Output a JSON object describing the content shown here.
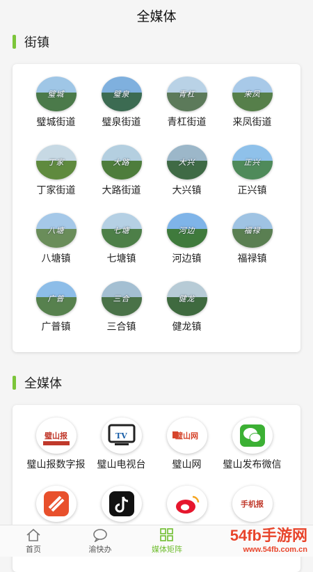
{
  "header": {
    "title": "全媒体"
  },
  "sections": [
    {
      "title": "街镇",
      "items": [
        {
          "label": "璧城街道",
          "caption": "璧城",
          "sky": "#9fc6e6",
          "land": "#4b7a4a"
        },
        {
          "label": "璧泉街道",
          "caption": "璧泉",
          "sky": "#7fb0de",
          "land": "#3c6b52"
        },
        {
          "label": "青杠街道",
          "caption": "青杠",
          "sky": "#b9d2e6",
          "land": "#5c7a5a"
        },
        {
          "label": "来凤街道",
          "caption": "来凤",
          "sky": "#a8c9e8",
          "land": "#567f4a"
        },
        {
          "label": "丁家街道",
          "caption": "丁家",
          "sky": "#c7d9e4",
          "land": "#5f8a3e"
        },
        {
          "label": "大路街道",
          "caption": "大路",
          "sky": "#b4cfe0",
          "land": "#4e7d3c"
        },
        {
          "label": "大兴镇",
          "caption": "大兴",
          "sky": "#9cb7c9",
          "land": "#3f6a45"
        },
        {
          "label": "正兴镇",
          "caption": "正兴",
          "sky": "#8fc1ea",
          "land": "#4f8a5a"
        },
        {
          "label": "八塘镇",
          "caption": "八塘",
          "sky": "#a5c8e8",
          "land": "#6a8d5a"
        },
        {
          "label": "七塘镇",
          "caption": "七塘",
          "sky": "#b5d0e4",
          "land": "#4d7f48"
        },
        {
          "label": "河边镇",
          "caption": "河边",
          "sky": "#7fb4e8",
          "land": "#3f7a3c"
        },
        {
          "label": "福禄镇",
          "caption": "福禄",
          "sky": "#9fc3e3",
          "land": "#5a7f52"
        },
        {
          "label": "广普镇",
          "caption": "广普",
          "sky": "#8dbde8",
          "land": "#57814e"
        },
        {
          "label": "三合镇",
          "caption": "三合",
          "sky": "#a4bfd2",
          "land": "#4a7248"
        },
        {
          "label": "健龙镇",
          "caption": "健龙",
          "sky": "#b7cbd6",
          "land": "#3f6a3f"
        }
      ]
    },
    {
      "title": "全媒体",
      "items": [
        {
          "label": "璧山报数字报",
          "icon": "newspaper-logo-icon",
          "logo_text": "璧山报",
          "color": "#c0392b"
        },
        {
          "label": "璧山电视台",
          "icon": "tv-icon",
          "logo_text": "TV",
          "color": "#1a5fa8"
        },
        {
          "label": "璧山网",
          "icon": "website-logo-icon",
          "logo_text": "璧山网",
          "color": "#d6452c"
        },
        {
          "label": "璧山发布微信",
          "icon": "wechat-icon",
          "logo_text": "",
          "color": "#3cb034"
        },
        {
          "label": "",
          "icon": "app-logo-icon",
          "logo_text": "",
          "color": "#e8502c"
        },
        {
          "label": "",
          "icon": "douyin-icon",
          "logo_text": "",
          "color": "#111111"
        },
        {
          "label": "",
          "icon": "weibo-icon",
          "logo_text": "",
          "color": "#e6162d"
        },
        {
          "label": "",
          "icon": "mobile-newspaper-icon",
          "logo_text": "手机报",
          "color": "#c0392b"
        }
      ]
    }
  ],
  "tabs": [
    {
      "label": "首页",
      "icon": "home-icon",
      "active": false
    },
    {
      "label": "渝快办",
      "icon": "chat-bubble-icon",
      "active": false
    },
    {
      "label": "媒体矩阵",
      "icon": "grid-icon",
      "active": true
    }
  ],
  "watermark": {
    "main": "54fb手游网",
    "sub": "www.54fb.com.cn"
  },
  "colors": {
    "accent": "#7cc53a",
    "active_tab": "#6fbd2e"
  }
}
